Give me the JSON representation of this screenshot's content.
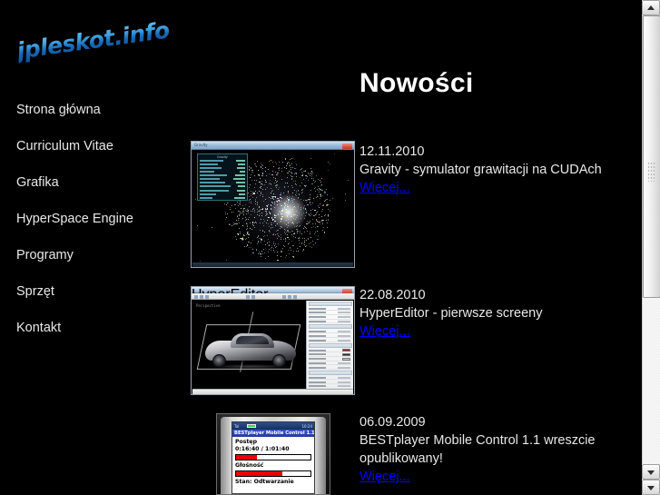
{
  "site": {
    "logo_text": "jpleskot.info",
    "logo_color": "#2b8ada"
  },
  "sidebar": {
    "items": [
      {
        "label": "Strona główna"
      },
      {
        "label": "Curriculum Vitae"
      },
      {
        "label": "Grafika"
      },
      {
        "label": "HyperSpace Engine"
      },
      {
        "label": "Programy"
      },
      {
        "label": "Sprzęt"
      },
      {
        "label": "Kontakt"
      }
    ]
  },
  "main": {
    "title": "Nowości",
    "link_color": "#0000ff",
    "news": [
      {
        "date": "12.11.2010",
        "headline": "Gravity - symulator grawitacji na CUDAch",
        "more_label": "Więcej...",
        "thumbnail_name": "gravity-simulator-screenshot",
        "thumbnail": {
          "window_title": "Gravity",
          "stats_title": "Gravity"
        }
      },
      {
        "date": "22.08.2010",
        "headline": "HyperEditor - pierwsze screeny",
        "more_label": "Więcej...",
        "thumbnail_name": "hypereditor-screenshot",
        "thumbnail": {
          "window_title": "HyperEditor",
          "viewport_hud": "Perspective"
        }
      },
      {
        "date": "06.09.2009",
        "headline_line1": "BESTplayer Mobile Control 1.1 wreszcie",
        "headline_line2": "opublikowany!",
        "more_label": "Więcej...",
        "thumbnail_name": "bestplayer-mobile-screenshot",
        "thumbnail": {
          "status_signal": "Tal",
          "status_clock": "10:24",
          "app_title": "BESTplayer Mobile Control 1.1",
          "progress_label": "Postęp",
          "progress_time": "0:16:40 / 1:01:40",
          "progress_percent": 28,
          "volume_label": "Głośność",
          "volume_percent": 62,
          "state_label": "Stan: Odtwarzanie"
        }
      }
    ]
  },
  "scrollbar": {
    "scroll_up_label": "▲",
    "scroll_down_label": "▼",
    "page_down_label": "▼"
  }
}
